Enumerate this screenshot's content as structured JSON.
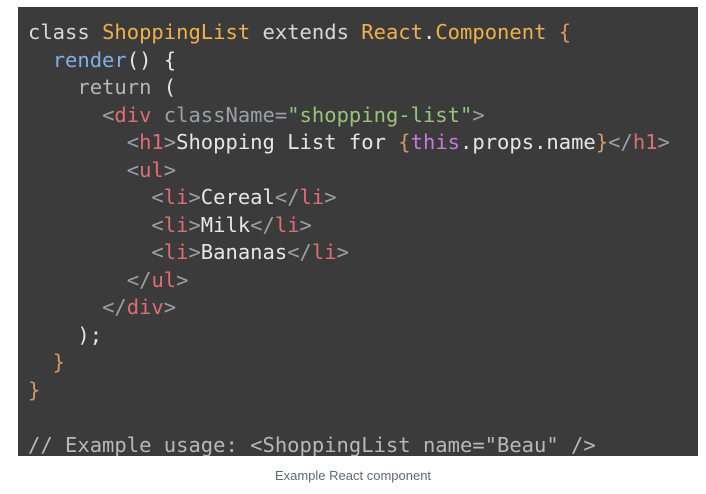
{
  "code": {
    "lines": [
      [
        {
          "t": "class ",
          "c": "kw"
        },
        {
          "t": "ShoppingList",
          "c": "class"
        },
        {
          "t": " extends ",
          "c": "kw"
        },
        {
          "t": "React",
          "c": "class"
        },
        {
          "t": ".",
          "c": "text"
        },
        {
          "t": "Component",
          "c": "class"
        },
        {
          "t": " {",
          "c": "brace"
        }
      ],
      [
        {
          "t": "  ",
          "c": "text"
        },
        {
          "t": "render",
          "c": "fn"
        },
        {
          "t": "() {",
          "c": "paren"
        }
      ],
      [
        {
          "t": "    ",
          "c": "text"
        },
        {
          "t": "return",
          "c": "ret"
        },
        {
          "t": " (",
          "c": "paren"
        }
      ],
      [
        {
          "t": "      ",
          "c": "text"
        },
        {
          "t": "<",
          "c": "angle"
        },
        {
          "t": "div",
          "c": "tag"
        },
        {
          "t": " className",
          "c": "attr"
        },
        {
          "t": "=",
          "c": "angle"
        },
        {
          "t": "\"shopping-list\"",
          "c": "str"
        },
        {
          "t": ">",
          "c": "angle"
        }
      ],
      [
        {
          "t": "        ",
          "c": "text"
        },
        {
          "t": "<",
          "c": "angle"
        },
        {
          "t": "h1",
          "c": "tag"
        },
        {
          "t": ">",
          "c": "angle"
        },
        {
          "t": "Shopping List for ",
          "c": "text"
        },
        {
          "t": "{",
          "c": "brace"
        },
        {
          "t": "this",
          "c": "this"
        },
        {
          "t": ".props.name",
          "c": "prop"
        },
        {
          "t": "}",
          "c": "brace"
        },
        {
          "t": "</",
          "c": "angle"
        },
        {
          "t": "h1",
          "c": "tag"
        },
        {
          "t": ">",
          "c": "angle"
        }
      ],
      [
        {
          "t": "        ",
          "c": "text"
        },
        {
          "t": "<",
          "c": "angle"
        },
        {
          "t": "ul",
          "c": "tag"
        },
        {
          "t": ">",
          "c": "angle"
        }
      ],
      [
        {
          "t": "          ",
          "c": "text"
        },
        {
          "t": "<",
          "c": "angle"
        },
        {
          "t": "li",
          "c": "tag"
        },
        {
          "t": ">",
          "c": "angle"
        },
        {
          "t": "Cereal",
          "c": "text"
        },
        {
          "t": "</",
          "c": "angle"
        },
        {
          "t": "li",
          "c": "tag"
        },
        {
          "t": ">",
          "c": "angle"
        }
      ],
      [
        {
          "t": "          ",
          "c": "text"
        },
        {
          "t": "<",
          "c": "angle"
        },
        {
          "t": "li",
          "c": "tag"
        },
        {
          "t": ">",
          "c": "angle"
        },
        {
          "t": "Milk",
          "c": "text"
        },
        {
          "t": "</",
          "c": "angle"
        },
        {
          "t": "li",
          "c": "tag"
        },
        {
          "t": ">",
          "c": "angle"
        }
      ],
      [
        {
          "t": "          ",
          "c": "text"
        },
        {
          "t": "<",
          "c": "angle"
        },
        {
          "t": "li",
          "c": "tag"
        },
        {
          "t": ">",
          "c": "angle"
        },
        {
          "t": "Bananas",
          "c": "text"
        },
        {
          "t": "</",
          "c": "angle"
        },
        {
          "t": "li",
          "c": "tag"
        },
        {
          "t": ">",
          "c": "angle"
        }
      ],
      [
        {
          "t": "        ",
          "c": "text"
        },
        {
          "t": "</",
          "c": "angle"
        },
        {
          "t": "ul",
          "c": "tag"
        },
        {
          "t": ">",
          "c": "angle"
        }
      ],
      [
        {
          "t": "      ",
          "c": "text"
        },
        {
          "t": "</",
          "c": "angle"
        },
        {
          "t": "div",
          "c": "tag"
        },
        {
          "t": ">",
          "c": "angle"
        }
      ],
      [
        {
          "t": "    );",
          "c": "paren"
        }
      ],
      [
        {
          "t": "  }",
          "c": "brace"
        }
      ],
      [
        {
          "t": "}",
          "c": "brace"
        }
      ],
      [
        {
          "t": "",
          "c": "text"
        }
      ],
      [
        {
          "t": "// Example usage: <ShoppingList name=\"Beau\" />",
          "c": "comment"
        }
      ]
    ]
  },
  "caption": "Example React component"
}
